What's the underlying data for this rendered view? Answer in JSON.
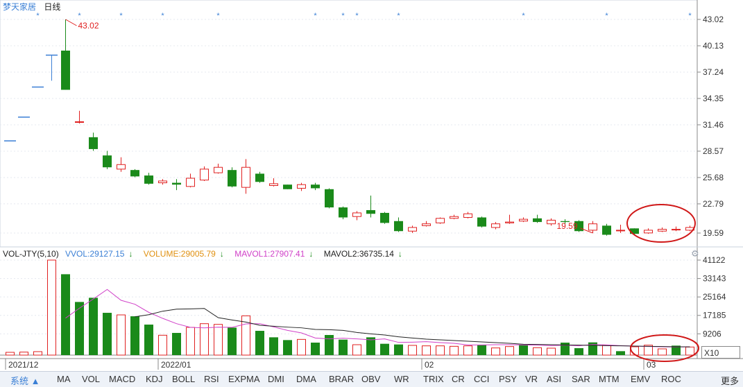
{
  "header": {
    "stock_name": "梦天家居",
    "period": "日线"
  },
  "volume_header": {
    "indicator": "VOL-JTY(5,10)",
    "vvol": "VVOL:29127.15",
    "volume": "VOLUME:29005.79",
    "mavol1": "MAVOL1:27907.41",
    "mavol2": "MAVOL2:36735.14",
    "arrow": "↓"
  },
  "price_axis": [
    "43.02",
    "40.13",
    "37.24",
    "34.35",
    "31.46",
    "28.57",
    "25.68",
    "22.79",
    "19.59"
  ],
  "volume_axis": [
    "41122",
    "33143",
    "25164",
    "17185",
    "9206"
  ],
  "x_axis_labels": [
    "2021/12",
    "2022/01",
    "02",
    "03"
  ],
  "annotations": {
    "high": "43.02",
    "low": "19.59"
  },
  "x10_box": "X10",
  "tabs": [
    "系统",
    "MA",
    "VOL",
    "MACD",
    "KDJ",
    "BOLL",
    "RSI",
    "EXPMA",
    "DMI",
    "DMA",
    "BRAR",
    "OBV",
    "WR",
    "TRIX",
    "CR",
    "CCI",
    "PSY",
    "VR",
    "ASI",
    "SAR",
    "MTM",
    "EMV",
    "ROC",
    "更多"
  ],
  "colors": {
    "up": "#e02020",
    "down": "#1a8a1a",
    "limit_up": "#3a7fd5",
    "mavol1": "#d040c8",
    "mavol2": "#222222",
    "circle": "#d01818"
  },
  "chart_data": {
    "type": "candlestick",
    "candles": [
      {
        "o": 29.7,
        "c": 29.7,
        "h": 29.7,
        "l": 29.7,
        "limit": true
      },
      {
        "o": 32.3,
        "c": 32.3,
        "h": 32.3,
        "l": 32.3,
        "limit": true
      },
      {
        "o": 35.6,
        "c": 35.6,
        "h": 35.6,
        "l": 35.6,
        "limit": true
      },
      {
        "o": 39.1,
        "c": 39.1,
        "h": 39.1,
        "l": 36.3,
        "limit": true
      },
      {
        "o": 39.6,
        "c": 35.3,
        "h": 43.02,
        "l": 35.3
      },
      {
        "o": 31.8,
        "c": 31.8,
        "h": 33.0,
        "l": 31.6
      },
      {
        "o": 30.1,
        "c": 28.8,
        "h": 30.6,
        "l": 28.6
      },
      {
        "o": 28.1,
        "c": 26.8,
        "h": 28.6,
        "l": 26.6
      },
      {
        "o": 26.6,
        "c": 27.1,
        "h": 27.9,
        "l": 26.3
      },
      {
        "o": 26.5,
        "c": 25.8,
        "h": 26.6,
        "l": 25.7
      },
      {
        "o": 25.9,
        "c": 25.0,
        "h": 26.2,
        "l": 24.9
      },
      {
        "o": 25.1,
        "c": 25.3,
        "h": 25.5,
        "l": 24.9
      },
      {
        "o": 25.1,
        "c": 24.9,
        "h": 25.5,
        "l": 24.3
      },
      {
        "o": 24.7,
        "c": 25.6,
        "h": 26.1,
        "l": 24.6
      },
      {
        "o": 25.4,
        "c": 26.6,
        "h": 26.9,
        "l": 25.3
      },
      {
        "o": 26.2,
        "c": 26.8,
        "h": 27.2,
        "l": 26.1
      },
      {
        "o": 26.5,
        "c": 24.7,
        "h": 26.8,
        "l": 24.6
      },
      {
        "o": 24.6,
        "c": 26.8,
        "h": 27.7,
        "l": 23.9
      },
      {
        "o": 26.1,
        "c": 25.2,
        "h": 26.3,
        "l": 25.1
      },
      {
        "o": 24.8,
        "c": 25.0,
        "h": 25.6,
        "l": 24.7
      },
      {
        "o": 24.9,
        "c": 24.4,
        "h": 24.9,
        "l": 24.4
      },
      {
        "o": 24.5,
        "c": 24.9,
        "h": 25.1,
        "l": 24.2
      },
      {
        "o": 24.9,
        "c": 24.5,
        "h": 25.1,
        "l": 24.3
      },
      {
        "o": 24.4,
        "c": 22.4,
        "h": 24.5,
        "l": 22.3
      },
      {
        "o": 22.4,
        "c": 21.3,
        "h": 22.5,
        "l": 21.1
      },
      {
        "o": 21.4,
        "c": 21.8,
        "h": 22.0,
        "l": 21.0
      },
      {
        "o": 22.1,
        "c": 21.7,
        "h": 23.7,
        "l": 21.3
      },
      {
        "o": 21.8,
        "c": 20.7,
        "h": 21.9,
        "l": 20.6
      },
      {
        "o": 20.9,
        "c": 19.8,
        "h": 21.3,
        "l": 19.7
      },
      {
        "o": 19.8,
        "c": 20.2,
        "h": 20.4,
        "l": 19.6
      },
      {
        "o": 20.4,
        "c": 20.6,
        "h": 20.9,
        "l": 20.3
      },
      {
        "o": 20.7,
        "c": 21.2,
        "h": 21.3,
        "l": 20.6
      },
      {
        "o": 21.2,
        "c": 21.4,
        "h": 21.6,
        "l": 21.1
      },
      {
        "o": 21.3,
        "c": 21.7,
        "h": 21.9,
        "l": 21.2
      },
      {
        "o": 21.3,
        "c": 20.3,
        "h": 21.4,
        "l": 20.2
      },
      {
        "o": 20.2,
        "c": 20.6,
        "h": 20.8,
        "l": 20.0
      },
      {
        "o": 20.7,
        "c": 20.8,
        "h": 21.6,
        "l": 20.6
      },
      {
        "o": 20.9,
        "c": 21.1,
        "h": 21.3,
        "l": 20.8
      },
      {
        "o": 21.2,
        "c": 20.8,
        "h": 21.6,
        "l": 20.7
      },
      {
        "o": 20.6,
        "c": 21.0,
        "h": 21.2,
        "l": 20.4
      },
      {
        "o": 20.9,
        "c": 20.8,
        "h": 21.1,
        "l": 20.6
      },
      {
        "o": 20.9,
        "c": 19.8,
        "h": 21.0,
        "l": 19.7
      },
      {
        "o": 19.9,
        "c": 20.6,
        "h": 20.9,
        "l": 19.59
      },
      {
        "o": 20.4,
        "c": 19.4,
        "h": 20.6,
        "l": 19.3
      },
      {
        "o": 19.9,
        "c": 19.9,
        "h": 20.5,
        "l": 19.6
      },
      {
        "o": 20.1,
        "c": 19.5,
        "h": 20.1,
        "l": 19.4
      },
      {
        "o": 19.6,
        "c": 19.9,
        "h": 20.1,
        "l": 19.5
      },
      {
        "o": 19.8,
        "c": 20.0,
        "h": 20.2,
        "l": 19.7
      },
      {
        "o": 20.0,
        "c": 20.0,
        "h": 20.3,
        "l": 19.8
      },
      {
        "o": 19.9,
        "c": 20.2,
        "h": 20.4,
        "l": 19.8
      }
    ],
    "volumes": [
      {
        "v": 1200,
        "up": true
      },
      {
        "v": 1300,
        "up": true
      },
      {
        "v": 1500,
        "up": true
      },
      {
        "v": 41122,
        "up": true
      },
      {
        "v": 35000,
        "up": false
      },
      {
        "v": 23000,
        "up": false
      },
      {
        "v": 24800,
        "up": false
      },
      {
        "v": 18300,
        "up": false
      },
      {
        "v": 17400,
        "up": true
      },
      {
        "v": 16800,
        "up": false
      },
      {
        "v": 13200,
        "up": false
      },
      {
        "v": 8600,
        "up": true
      },
      {
        "v": 9600,
        "up": false
      },
      {
        "v": 12000,
        "up": true
      },
      {
        "v": 13600,
        "up": true
      },
      {
        "v": 13300,
        "up": true
      },
      {
        "v": 11900,
        "up": false
      },
      {
        "v": 17000,
        "up": true
      },
      {
        "v": 10500,
        "up": false
      },
      {
        "v": 7700,
        "up": false
      },
      {
        "v": 6500,
        "up": false
      },
      {
        "v": 6800,
        "up": true
      },
      {
        "v": 5400,
        "up": false
      },
      {
        "v": 8700,
        "up": false
      },
      {
        "v": 6700,
        "up": false
      },
      {
        "v": 4500,
        "up": true
      },
      {
        "v": 7700,
        "up": false
      },
      {
        "v": 4900,
        "up": false
      },
      {
        "v": 4600,
        "up": false
      },
      {
        "v": 4200,
        "up": true
      },
      {
        "v": 4000,
        "up": true
      },
      {
        "v": 4000,
        "up": true
      },
      {
        "v": 3800,
        "up": true
      },
      {
        "v": 4000,
        "up": true
      },
      {
        "v": 4500,
        "up": false
      },
      {
        "v": 3100,
        "up": true
      },
      {
        "v": 3700,
        "up": true
      },
      {
        "v": 4500,
        "up": false
      },
      {
        "v": 3200,
        "up": true
      },
      {
        "v": 3000,
        "up": true
      },
      {
        "v": 5400,
        "up": false
      },
      {
        "v": 3000,
        "up": false
      },
      {
        "v": 5500,
        "up": false
      },
      {
        "v": 4200,
        "up": true
      },
      {
        "v": 1700,
        "up": false
      },
      {
        "v": 3600,
        "up": true
      },
      {
        "v": 4300,
        "up": true
      },
      {
        "v": 2700,
        "up": true
      },
      {
        "v": 4100,
        "up": false
      },
      {
        "v": 3500,
        "up": true
      }
    ],
    "mavol1": [
      null,
      null,
      null,
      null,
      16000,
      20300,
      24300,
      28400,
      23700,
      22000,
      18500,
      15900,
      13600,
      12000,
      11800,
      12100,
      12000,
      13500,
      13600,
      12200,
      10700,
      9600,
      7400,
      7000,
      7300,
      7000,
      6600,
      7000,
      5500,
      5600,
      5800,
      5400,
      5100,
      4400,
      4400,
      4500,
      4500,
      4400,
      4300,
      4100,
      4300,
      4000,
      4600,
      4400,
      4100,
      3900,
      3700,
      3600,
      3500,
      3600
    ],
    "mavol2": [
      null,
      null,
      null,
      null,
      null,
      null,
      null,
      null,
      null,
      16600,
      17500,
      19000,
      19900,
      20000,
      20200,
      16200,
      15200,
      14300,
      12900,
      12500,
      12100,
      11800,
      11100,
      11000,
      10700,
      9800,
      9200,
      8700,
      7900,
      7400,
      6900,
      6600,
      6300,
      6000,
      5700,
      5400,
      5100,
      4700,
      4600,
      4500,
      4400,
      4300,
      4200,
      4100,
      4000,
      3900,
      3800,
      3700,
      3600,
      3550
    ],
    "limit_up_markers": [
      1,
      4,
      7,
      10,
      14,
      21,
      23,
      24,
      27,
      36,
      42,
      48
    ]
  }
}
